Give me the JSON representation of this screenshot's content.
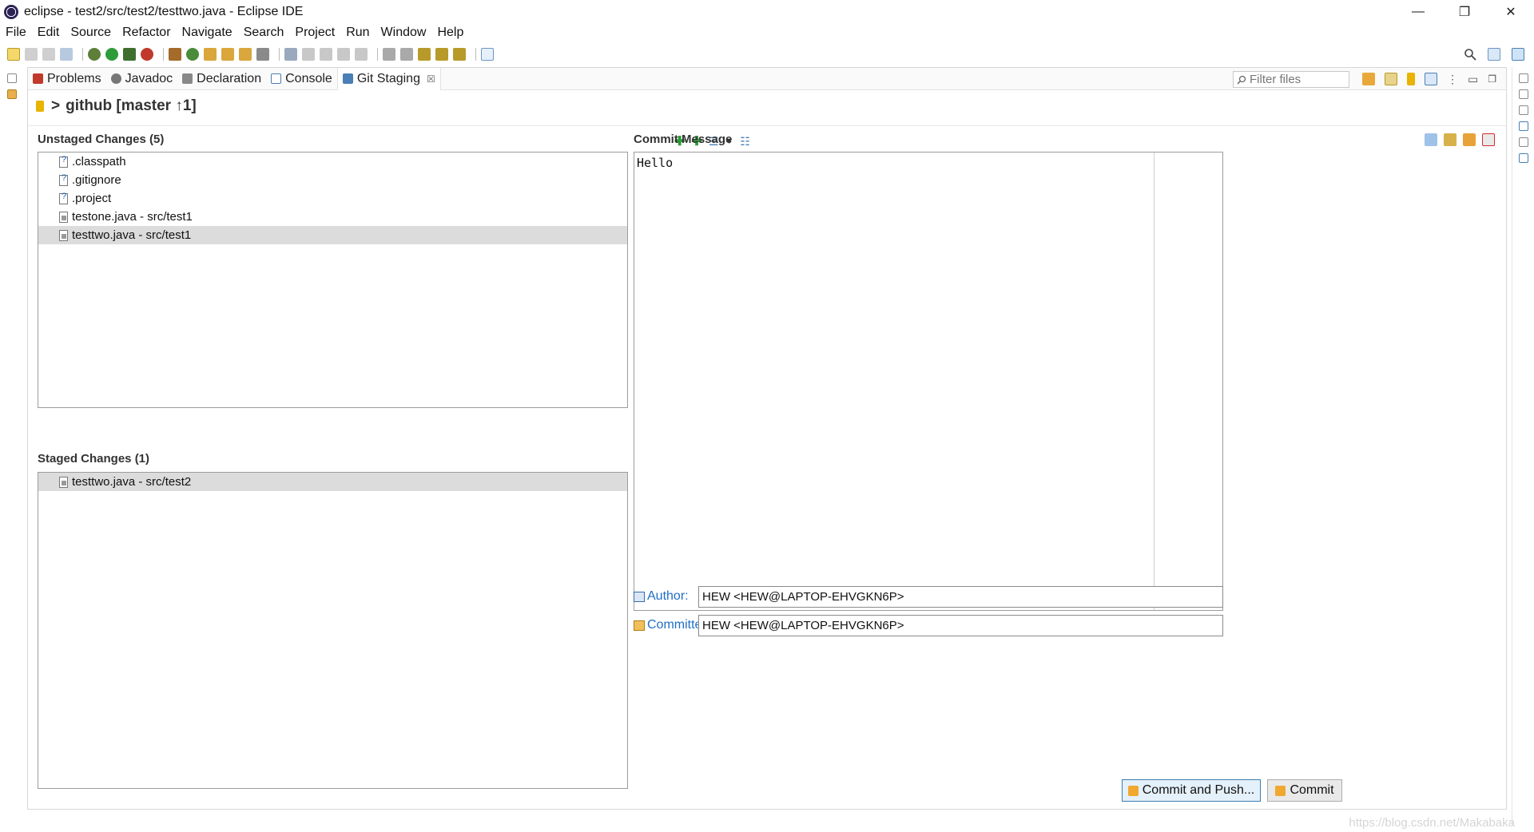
{
  "window": {
    "title": "eclipse - test2/src/test2/testtwo.java - Eclipse IDE",
    "minimize": "—",
    "restore": "❐",
    "close": "✕"
  },
  "menu": [
    "File",
    "Edit",
    "Source",
    "Refactor",
    "Navigate",
    "Search",
    "Project",
    "Run",
    "Window",
    "Help"
  ],
  "tabs": [
    {
      "label": "Problems",
      "icon": "problems-icon"
    },
    {
      "label": "Javadoc",
      "icon": "javadoc-icon"
    },
    {
      "label": "Declaration",
      "icon": "declaration-icon"
    },
    {
      "label": "Console",
      "icon": "console-icon"
    },
    {
      "label": "Git Staging",
      "icon": "git-staging-icon",
      "close": "☒"
    }
  ],
  "filter": {
    "placeholder": "Filter files"
  },
  "repo": {
    "arrow": ">",
    "label": "github [master ↑1]"
  },
  "unstaged": {
    "title": "Unstaged Changes (5)",
    "files": [
      {
        "name": ".classpath",
        "kind": "untracked"
      },
      {
        "name": ".gitignore",
        "kind": "untracked"
      },
      {
        "name": ".project",
        "kind": "untracked"
      },
      {
        "name": "testone.java - src/test1",
        "kind": "modified"
      },
      {
        "name": "testtwo.java - src/test1",
        "kind": "modified",
        "selected": true
      }
    ]
  },
  "staged": {
    "title": "Staged Changes (1)",
    "files": [
      {
        "name": "testtwo.java - src/test2",
        "kind": "modified",
        "selected": true
      }
    ]
  },
  "commit": {
    "title": "Commit Message",
    "message": "Hello",
    "author_label": "Author:",
    "author_value": "HEW <HEW@LAPTOP-EHVGKN6P>",
    "committer_label": "Committer:",
    "committer_value": "HEW <HEW@LAPTOP-EHVGKN6P>",
    "commit_push_label": "Commit and Push...",
    "commit_label": "Commit"
  },
  "status": {
    "watermark": "https://blog.csdn.net/Makabaka"
  },
  "colors": {
    "accent": "#1f6fc5",
    "selection": "#dcdcdc",
    "git_yellow": "#e8b400"
  }
}
